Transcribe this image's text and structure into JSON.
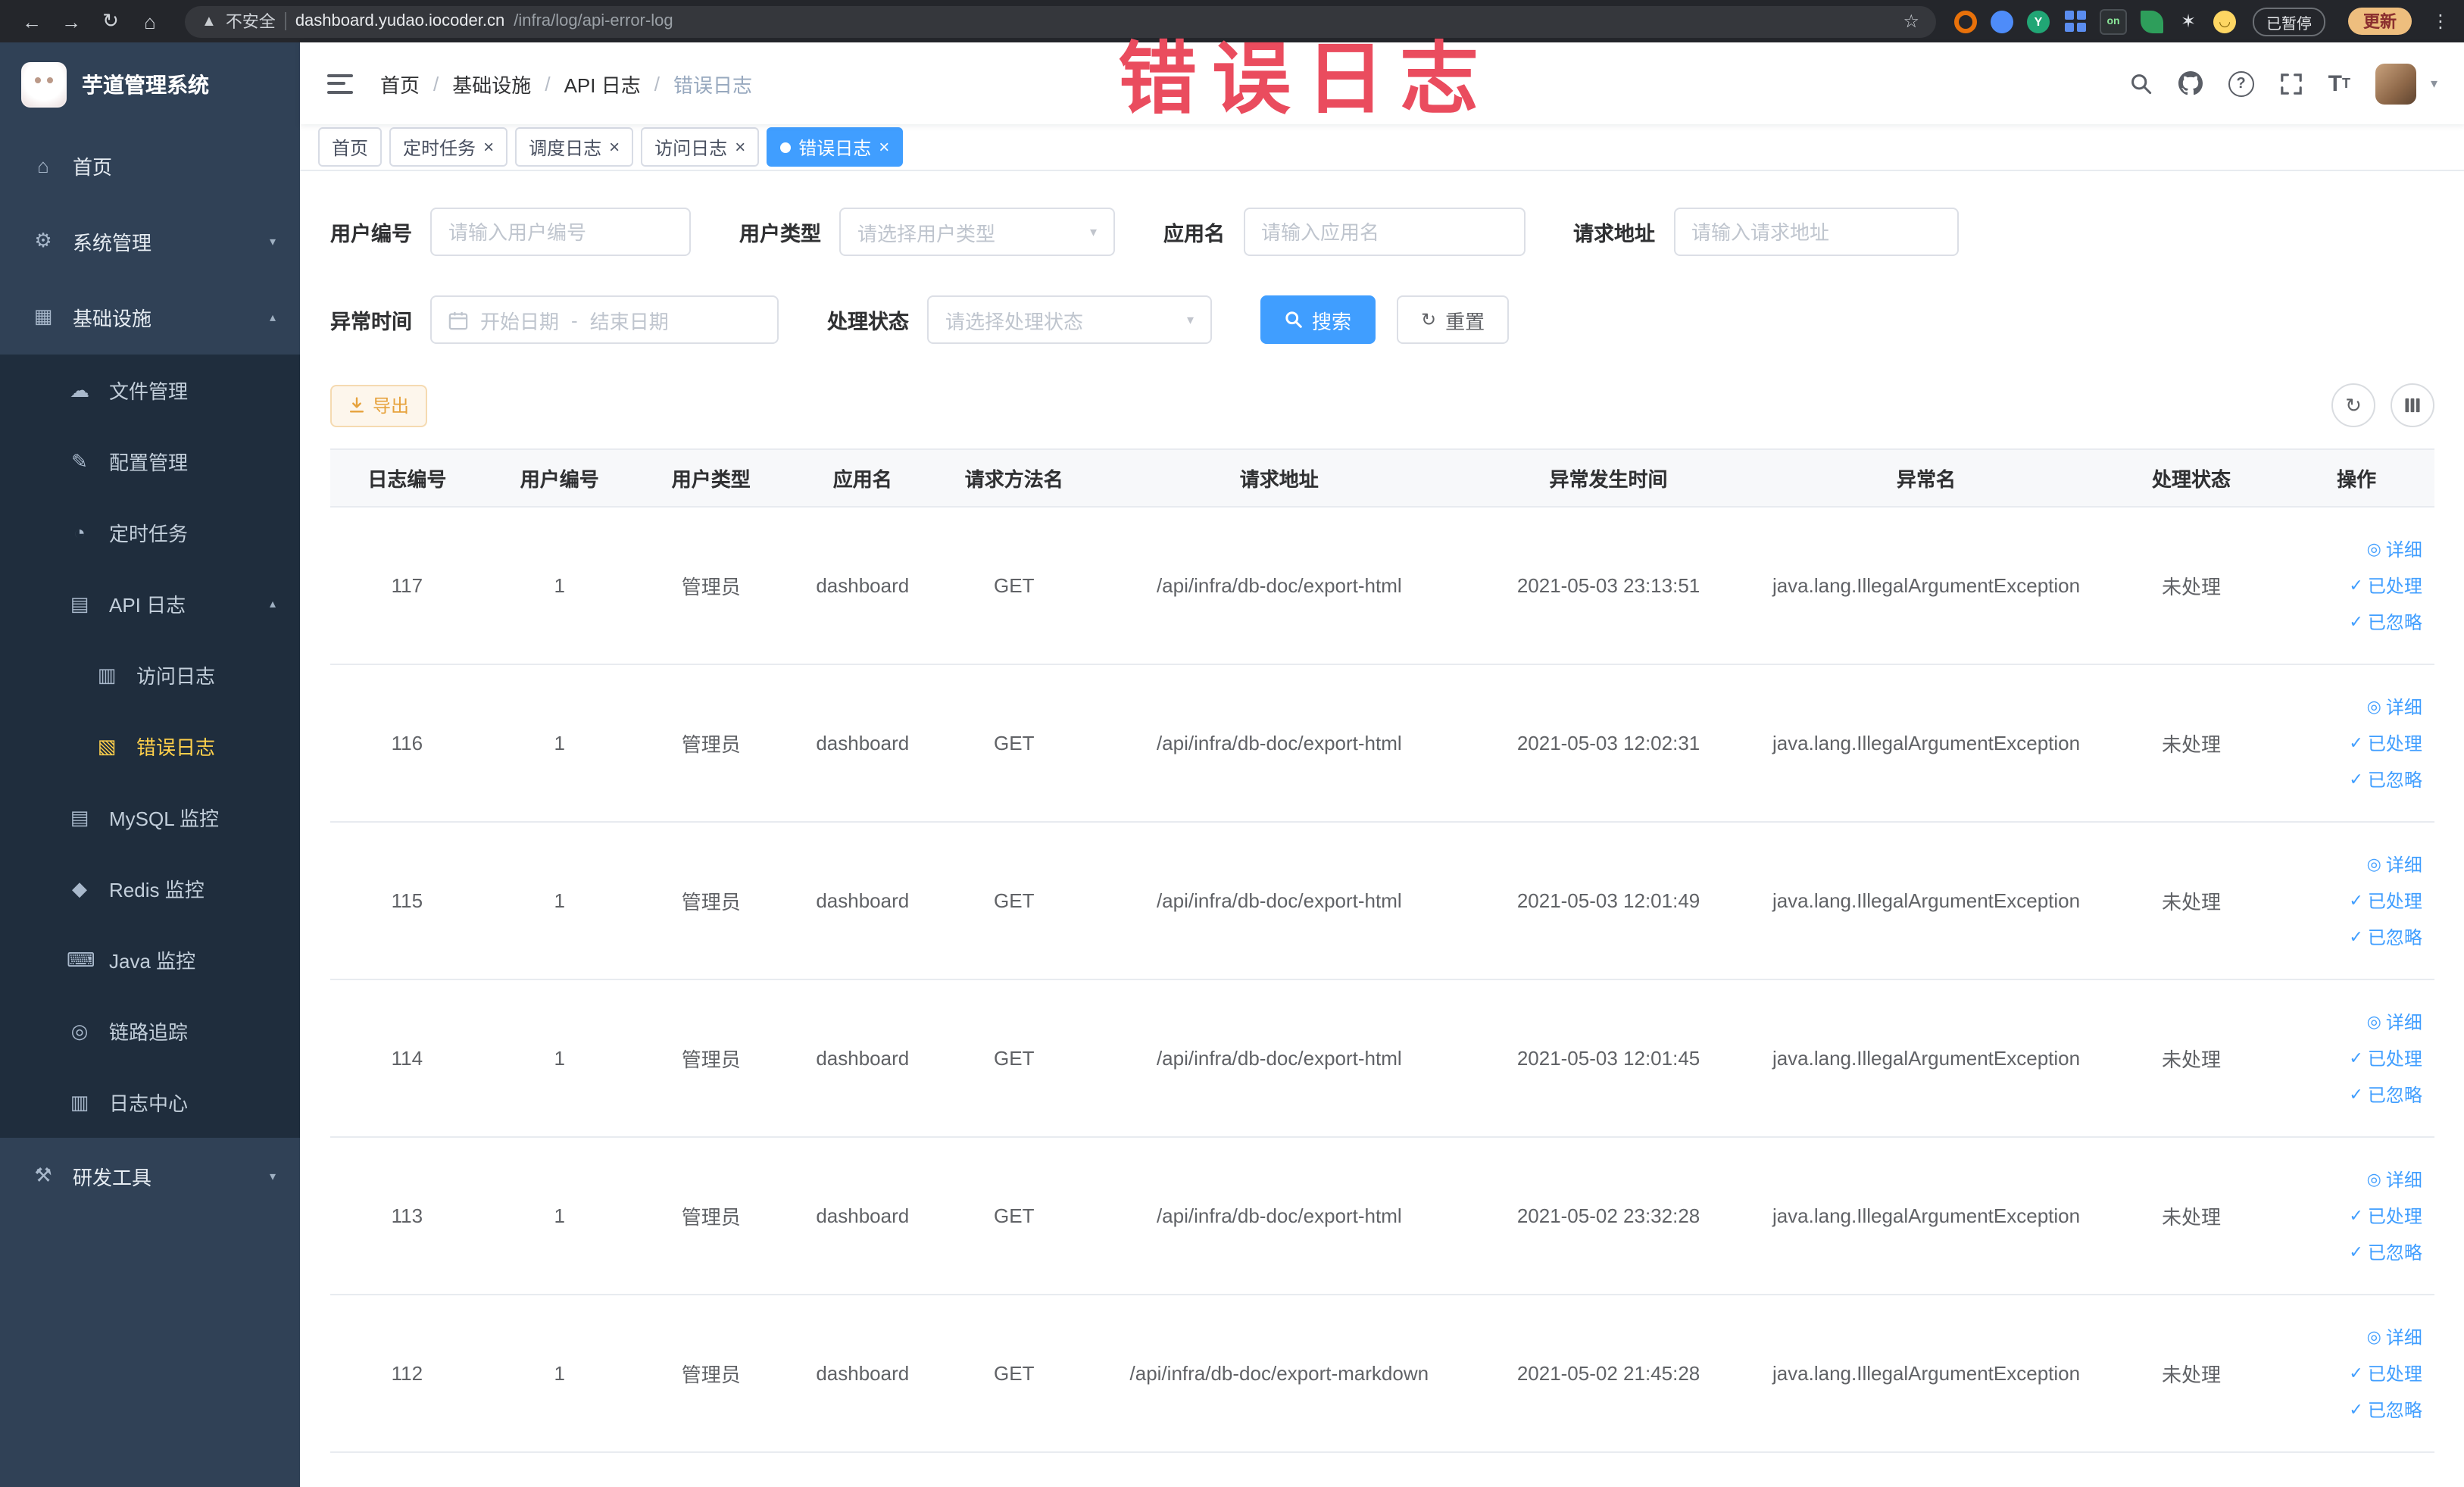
{
  "browser": {
    "security_label": "不安全",
    "url_host": "dashboard.yudao.iocoder.cn",
    "url_path": "/infra/log/api-error-log",
    "paused_badge": "已暂停",
    "update_button": "更新",
    "extension_on_badge": "on",
    "extension_y_badge": "Y"
  },
  "sidebar": {
    "app_title": "芋道管理系统",
    "menu": [
      {
        "id": "home",
        "label": "首页",
        "icon": "home-icon",
        "level": 1
      },
      {
        "id": "system-management",
        "label": "系统管理",
        "icon": "gear-icon",
        "level": 1,
        "arrow": "down"
      },
      {
        "id": "infrastructure",
        "label": "基础设施",
        "icon": "infrastructure-icon",
        "level": 1,
        "arrow": "up"
      },
      {
        "id": "file-management",
        "label": "文件管理",
        "icon": "file-icon",
        "level": 2
      },
      {
        "id": "config-management",
        "label": "配置管理",
        "icon": "config-icon",
        "level": 2
      },
      {
        "id": "scheduled-jobs",
        "label": "定时任务",
        "icon": "timer-icon",
        "level": 2
      },
      {
        "id": "api-log",
        "label": "API 日志",
        "icon": "api-log-icon",
        "level": 2,
        "arrow": "up"
      },
      {
        "id": "access-log",
        "label": "访问日志",
        "icon": "access-log-icon",
        "level": 3
      },
      {
        "id": "error-log",
        "label": "错误日志",
        "icon": "error-log-icon",
        "level": 3,
        "active": true
      },
      {
        "id": "mysql-monitor",
        "label": "MySQL 监控",
        "icon": "mysql-icon",
        "level": 2
      },
      {
        "id": "redis-monitor",
        "label": "Redis 监控",
        "icon": "redis-icon",
        "level": 2
      },
      {
        "id": "java-monitor",
        "label": "Java 监控",
        "icon": "java-icon",
        "level": 2
      },
      {
        "id": "link-trace",
        "label": "链路追踪",
        "icon": "trace-icon",
        "level": 2
      },
      {
        "id": "log-center",
        "label": "日志中心",
        "icon": "log-center-icon",
        "level": 2
      },
      {
        "id": "dev-tools",
        "label": "研发工具",
        "icon": "tools-icon",
        "level": 1,
        "arrow": "down"
      }
    ]
  },
  "navbar": {
    "breadcrumb": [
      {
        "label": "首页",
        "current": false
      },
      {
        "label": "基础设施",
        "current": false
      },
      {
        "label": "API 日志",
        "current": false
      },
      {
        "label": "错误日志",
        "current": true
      }
    ]
  },
  "tabs": [
    {
      "label": "首页",
      "closable": false,
      "active": false
    },
    {
      "label": "定时任务",
      "closable": true,
      "active": false
    },
    {
      "label": "调度日志",
      "closable": true,
      "active": false
    },
    {
      "label": "访问日志",
      "closable": true,
      "active": false
    },
    {
      "label": "错误日志",
      "closable": true,
      "active": true
    }
  ],
  "annotation": {
    "watermark": "错误日志",
    "color": "#ea4c5e"
  },
  "filters": {
    "user_id": {
      "label": "用户编号",
      "placeholder": "请输入用户编号"
    },
    "user_type": {
      "label": "用户类型",
      "placeholder": "请选择用户类型"
    },
    "app_name": {
      "label": "应用名",
      "placeholder": "请输入应用名"
    },
    "request_url": {
      "label": "请求地址",
      "placeholder": "请输入请求地址"
    },
    "exception_time": {
      "label": "异常时间",
      "start_placeholder": "开始日期",
      "separator": "-",
      "end_placeholder": "结束日期"
    },
    "process_status": {
      "label": "处理状态",
      "placeholder": "请选择处理状态"
    },
    "search_button": "搜索",
    "reset_button": "重置"
  },
  "toolbar": {
    "export_button": "导出"
  },
  "table": {
    "columns": [
      "日志编号",
      "用户编号",
      "用户类型",
      "应用名",
      "请求方法名",
      "请求地址",
      "异常发生时间",
      "异常名",
      "处理状态",
      "操作"
    ],
    "actions": [
      "详细",
      "已处理",
      "已忽略"
    ],
    "rows": [
      {
        "id": "117",
        "user_id": "1",
        "user_type": "管理员",
        "app_name": "dashboard",
        "method": "GET",
        "url": "/api/infra/db-doc/export-html",
        "time": "2021-05-03 23:13:51",
        "exception": "java.lang.IllegalArgumentException",
        "status": "未处理"
      },
      {
        "id": "116",
        "user_id": "1",
        "user_type": "管理员",
        "app_name": "dashboard",
        "method": "GET",
        "url": "/api/infra/db-doc/export-html",
        "time": "2021-05-03 12:02:31",
        "exception": "java.lang.IllegalArgumentException",
        "status": "未处理"
      },
      {
        "id": "115",
        "user_id": "1",
        "user_type": "管理员",
        "app_name": "dashboard",
        "method": "GET",
        "url": "/api/infra/db-doc/export-html",
        "time": "2021-05-03 12:01:49",
        "exception": "java.lang.IllegalArgumentException",
        "status": "未处理"
      },
      {
        "id": "114",
        "user_id": "1",
        "user_type": "管理员",
        "app_name": "dashboard",
        "method": "GET",
        "url": "/api/infra/db-doc/export-html",
        "time": "2021-05-03 12:01:45",
        "exception": "java.lang.IllegalArgumentException",
        "status": "未处理"
      },
      {
        "id": "113",
        "user_id": "1",
        "user_type": "管理员",
        "app_name": "dashboard",
        "method": "GET",
        "url": "/api/infra/db-doc/export-html",
        "time": "2021-05-02 23:32:28",
        "exception": "java.lang.IllegalArgumentException",
        "status": "未处理"
      },
      {
        "id": "112",
        "user_id": "1",
        "user_type": "管理员",
        "app_name": "dashboard",
        "method": "GET",
        "url": "/api/infra/db-doc/export-markdown",
        "time": "2021-05-02 21:45:28",
        "exception": "java.lang.IllegalArgumentException",
        "status": "未处理"
      }
    ]
  },
  "colors": {
    "accent": "#409eff",
    "active_menu": "#ffd04b",
    "warning": "#e6a23c"
  }
}
